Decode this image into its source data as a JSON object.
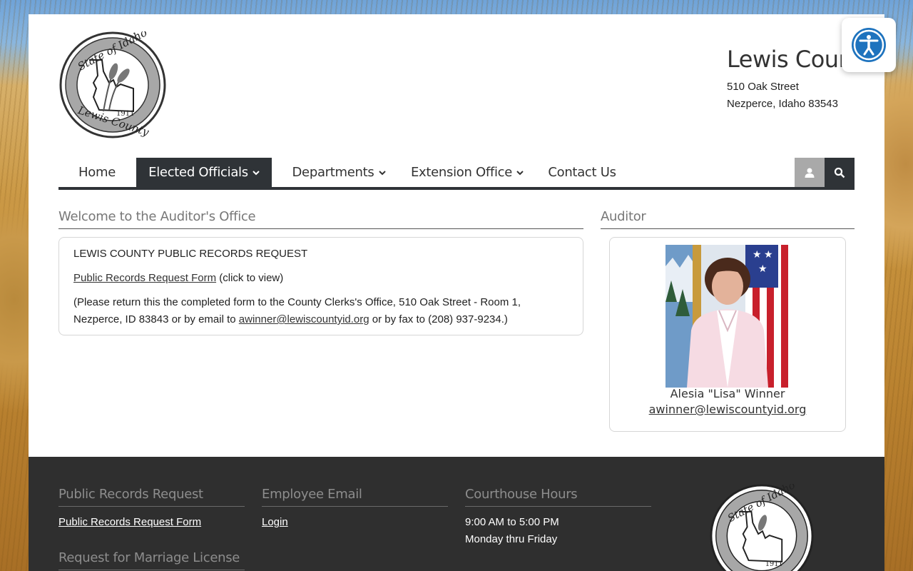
{
  "header": {
    "county_name": "Lewis County",
    "address_line1": "510 Oak Street",
    "address_line2": "Nezperce, Idaho 83543",
    "seal": {
      "top_text": "State of Idaho",
      "bottom_text": "Lewis County",
      "year": "1911"
    }
  },
  "nav": {
    "items": [
      {
        "label": "Home",
        "has_dropdown": false,
        "active": false
      },
      {
        "label": "Elected Officials",
        "has_dropdown": true,
        "active": true
      },
      {
        "label": "Departments",
        "has_dropdown": true,
        "active": false
      },
      {
        "label": "Extension Office",
        "has_dropdown": true,
        "active": false
      },
      {
        "label": "Contact Us",
        "has_dropdown": false,
        "active": false
      }
    ],
    "tools": {
      "login_icon": "user-icon",
      "search_icon": "search-icon"
    }
  },
  "main": {
    "title": "Welcome to the Auditor's Office",
    "heading": "LEWIS COUNTY PUBLIC RECORDS REQUEST",
    "form_link": "Public Records Request Form",
    "form_note": " (click to view)",
    "return_text_before": "(Please return this the completed form to the County Clerks's Office, 510 Oak Street - Room 1, Nezperce, ID 83843 or by email to ",
    "email": "awinner@lewiscountyid.org",
    "return_text_after": " or by fax to (208) 937-9234.)"
  },
  "sidebar": {
    "title": "Auditor",
    "person_name": "Alesia \"Lisa\" Winner",
    "person_email": "awinner@lewiscountyid.org"
  },
  "footer": {
    "col1": {
      "title": "Public Records Request",
      "link": "Public Records Request Form",
      "title2": "Request for Marriage License"
    },
    "col2": {
      "title": "Employee Email",
      "link": "Login"
    },
    "col3": {
      "title": "Courthouse Hours",
      "hours": "9:00 AM to 5:00 PM",
      "days": "Monday thru Friday"
    }
  },
  "accessibility": {
    "icon": "accessibility-icon"
  },
  "colors": {
    "nav_dark": "#2f3337",
    "footer_bg": "#2f2f2f",
    "access_blue": "#1e73be"
  }
}
